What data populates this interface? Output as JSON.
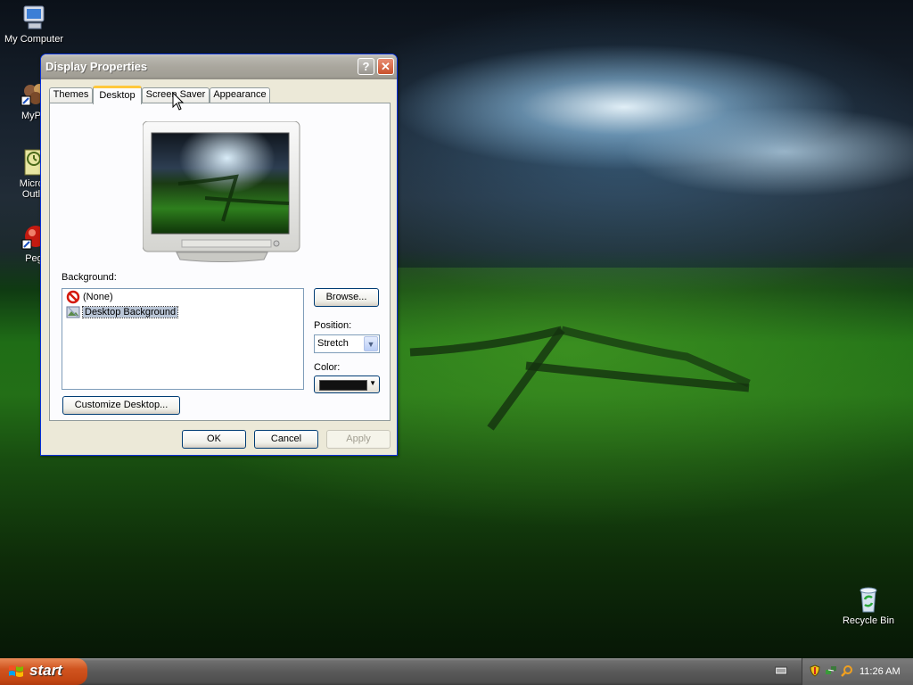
{
  "desktop": {
    "icons": [
      {
        "label": "My Computer",
        "icon": "my-computer-icon"
      },
      {
        "label": "MyPa",
        "icon": "my-pictures-icon"
      },
      {
        "label": "Micros Outlo",
        "icon": "outlook-icon"
      },
      {
        "label": "Peg",
        "icon": "pegasus-icon"
      },
      {
        "label": "Recycle Bin",
        "icon": "recycle-bin-icon"
      }
    ]
  },
  "dialog": {
    "title": "Display Properties",
    "tabs": [
      "Themes",
      "Desktop",
      "Screen Saver",
      "Appearance"
    ],
    "active_tab": "Desktop",
    "background_label": "Background:",
    "background_items": [
      {
        "label": "(None)",
        "icon": "none-icon"
      },
      {
        "label": "Desktop Background",
        "icon": "bitmap-icon",
        "selected": true
      }
    ],
    "browse_label": "Browse...",
    "position_label": "Position:",
    "position_value": "Stretch",
    "color_label": "Color:",
    "color_value": "#111111",
    "customize_label": "Customize Desktop...",
    "ok_label": "OK",
    "cancel_label": "Cancel",
    "apply_label": "Apply"
  },
  "taskbar": {
    "start_label": "start",
    "clock": "11:26 AM"
  }
}
